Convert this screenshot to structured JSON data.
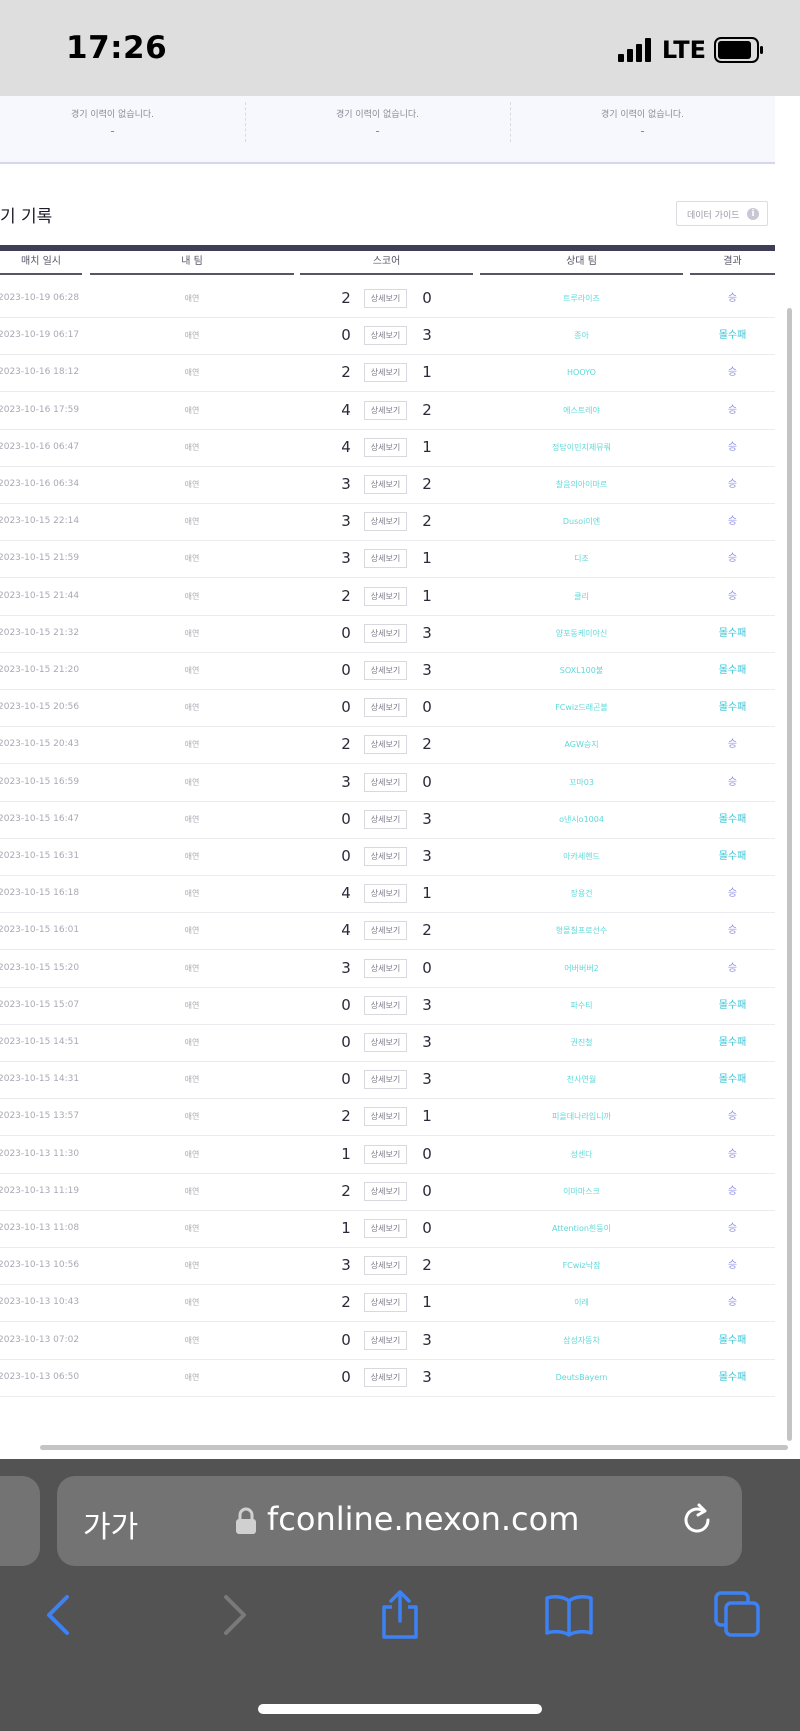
{
  "status": {
    "time": "17:26",
    "network": "LTE"
  },
  "summary": [
    {
      "text": "경기 이력이 없습니다.",
      "dash": "-"
    },
    {
      "text": "경기 이력이 없습니다.",
      "dash": "-"
    },
    {
      "text": "경기 이력이 없습니다.",
      "dash": "-"
    }
  ],
  "section_title": "기 기록",
  "data_guide": "데이터 가이드",
  "headers": {
    "date": "매치 일시",
    "my_team": "내 팀",
    "score": "스코어",
    "opponent": "상대 팀",
    "result": "결과"
  },
  "detail_label": "상세보기",
  "rows": [
    {
      "date": "2023-10-19 06:28",
      "mine": "애연",
      "s1": "2",
      "s2": "0",
      "opp": "트루라이즈",
      "res": "승",
      "win": true
    },
    {
      "date": "2023-10-19 06:17",
      "mine": "애연",
      "s1": "0",
      "s2": "3",
      "opp": "종아",
      "res": "몰수패",
      "win": false
    },
    {
      "date": "2023-10-16 18:12",
      "mine": "애연",
      "s1": "2",
      "s2": "1",
      "opp": "HOOYO",
      "res": "승",
      "win": true
    },
    {
      "date": "2023-10-16 17:59",
      "mine": "애연",
      "s1": "4",
      "s2": "2",
      "opp": "에스트레야",
      "res": "승",
      "win": true
    },
    {
      "date": "2023-10-16 06:47",
      "mine": "애연",
      "s1": "4",
      "s2": "1",
      "opp": "정담이민지제뮤뤄",
      "res": "승",
      "win": true
    },
    {
      "date": "2023-10-16 06:34",
      "mine": "애연",
      "s1": "3",
      "s2": "2",
      "opp": "찰음의아이마르",
      "res": "승",
      "win": true
    },
    {
      "date": "2023-10-15 22:14",
      "mine": "애연",
      "s1": "3",
      "s2": "2",
      "opp": "Dusoi이엔",
      "res": "승",
      "win": true
    },
    {
      "date": "2023-10-15 21:59",
      "mine": "애연",
      "s1": "3",
      "s2": "1",
      "opp": "디조",
      "res": "승",
      "win": true
    },
    {
      "date": "2023-10-15 21:44",
      "mine": "애연",
      "s1": "2",
      "s2": "1",
      "opp": "클리",
      "res": "승",
      "win": true
    },
    {
      "date": "2023-10-15 21:32",
      "mine": "애연",
      "s1": "0",
      "s2": "3",
      "opp": "양포동케이야신",
      "res": "몰수패",
      "win": false
    },
    {
      "date": "2023-10-15 21:20",
      "mine": "애연",
      "s1": "0",
      "s2": "3",
      "opp": "SOXL100불",
      "res": "몰수패",
      "win": false
    },
    {
      "date": "2023-10-15 20:56",
      "mine": "애연",
      "s1": "0",
      "s2": "0",
      "opp": "FCwiz드래곤볼",
      "res": "몰수패",
      "win": false
    },
    {
      "date": "2023-10-15 20:43",
      "mine": "애연",
      "s1": "2",
      "s2": "2",
      "opp": "AGW승지",
      "res": "승",
      "win": true
    },
    {
      "date": "2023-10-15 16:59",
      "mine": "애연",
      "s1": "3",
      "s2": "0",
      "opp": "꼬마03",
      "res": "승",
      "win": true
    },
    {
      "date": "2023-10-15 16:47",
      "mine": "애연",
      "s1": "0",
      "s2": "3",
      "opp": "o낸시o1004",
      "res": "몰수패",
      "win": false
    },
    {
      "date": "2023-10-15 16:31",
      "mine": "애연",
      "s1": "0",
      "s2": "3",
      "opp": "아카세헨드",
      "res": "몰수패",
      "win": false
    },
    {
      "date": "2023-10-15 16:18",
      "mine": "애연",
      "s1": "4",
      "s2": "1",
      "opp": "장용건",
      "res": "승",
      "win": true
    },
    {
      "date": "2023-10-15 16:01",
      "mine": "애연",
      "s1": "4",
      "s2": "2",
      "opp": "형몰칠프로선수",
      "res": "승",
      "win": true
    },
    {
      "date": "2023-10-15 15:20",
      "mine": "애연",
      "s1": "3",
      "s2": "0",
      "opp": "어버버버2",
      "res": "승",
      "win": true
    },
    {
      "date": "2023-10-15 15:07",
      "mine": "애연",
      "s1": "0",
      "s2": "3",
      "opp": "파수티",
      "res": "몰수패",
      "win": false
    },
    {
      "date": "2023-10-15 14:51",
      "mine": "애연",
      "s1": "0",
      "s2": "3",
      "opp": "권진철",
      "res": "몰수패",
      "win": false
    },
    {
      "date": "2023-10-15 14:31",
      "mine": "애연",
      "s1": "0",
      "s2": "3",
      "opp": "천사연월",
      "res": "몰수패",
      "win": false
    },
    {
      "date": "2023-10-15 13:57",
      "mine": "애연",
      "s1": "2",
      "s2": "1",
      "opp": "피을데나라입니까",
      "res": "승",
      "win": true
    },
    {
      "date": "2023-10-13 11:30",
      "mine": "애연",
      "s1": "1",
      "s2": "0",
      "opp": "성센다",
      "res": "승",
      "win": true
    },
    {
      "date": "2023-10-13 11:19",
      "mine": "애연",
      "s1": "2",
      "s2": "0",
      "opp": "이마마스크",
      "res": "승",
      "win": true
    },
    {
      "date": "2023-10-13 11:08",
      "mine": "애연",
      "s1": "1",
      "s2": "0",
      "opp": "Attention흰둥이",
      "res": "승",
      "win": true
    },
    {
      "date": "2023-10-13 10:56",
      "mine": "애연",
      "s1": "3",
      "s2": "2",
      "opp": "FCwiz낙잠",
      "res": "승",
      "win": true
    },
    {
      "date": "2023-10-13 10:43",
      "mine": "애연",
      "s1": "2",
      "s2": "1",
      "opp": "이레",
      "res": "승",
      "win": true
    },
    {
      "date": "2023-10-13 07:02",
      "mine": "애연",
      "s1": "0",
      "s2": "3",
      "opp": "삼성자동차",
      "res": "몰수패",
      "win": false
    },
    {
      "date": "2023-10-13 06:50",
      "mine": "애연",
      "s1": "0",
      "s2": "3",
      "opp": "DeutsBayern",
      "res": "몰수패",
      "win": false
    }
  ],
  "browser": {
    "text_size": "가가",
    "url": "fconline.nexon.com"
  },
  "colors": {
    "win": "#8e8ee6",
    "loss": "#36c4d8",
    "opponent": "#5fd8d8",
    "browser_bg": "#535353",
    "ios_blue": "#3d82f5"
  }
}
